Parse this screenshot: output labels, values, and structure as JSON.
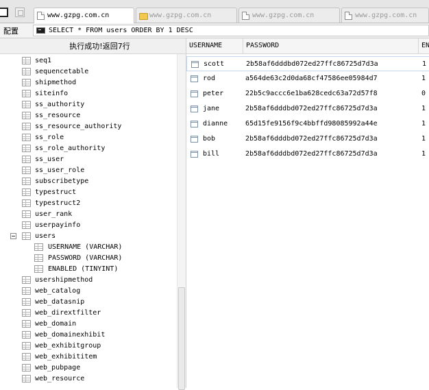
{
  "tabs": [
    {
      "label": "www.gzpg.com.cn",
      "icon": "page-icon",
      "active": true
    },
    {
      "label": "www.gzpg.com.cn",
      "icon": "folder-icon",
      "active": false
    },
    {
      "label": "www.gzpg.com.cn",
      "icon": "page-icon",
      "active": false
    },
    {
      "label": "www.gzpg.com.cn",
      "icon": "page-icon",
      "active": false
    }
  ],
  "toolbar": {
    "config_label": "配置",
    "sql": "SELECT * FROM users ORDER BY 1 DESC"
  },
  "status": "执行成功!返回7行",
  "tree": [
    {
      "label": "seq1",
      "level": 0
    },
    {
      "label": "sequencetable",
      "level": 0
    },
    {
      "label": "shipmethod",
      "level": 0
    },
    {
      "label": "siteinfo",
      "level": 0
    },
    {
      "label": "ss_authority",
      "level": 0
    },
    {
      "label": "ss_resource",
      "level": 0
    },
    {
      "label": "ss_resource_authority",
      "level": 0
    },
    {
      "label": "ss_role",
      "level": 0
    },
    {
      "label": "ss_role_authority",
      "level": 0
    },
    {
      "label": "ss_user",
      "level": 0
    },
    {
      "label": "ss_user_role",
      "level": 0
    },
    {
      "label": "subscribetype",
      "level": 0
    },
    {
      "label": "typestruct",
      "level": 0
    },
    {
      "label": "typestruct2",
      "level": 0
    },
    {
      "label": "user_rank",
      "level": 0
    },
    {
      "label": "userpayinfo",
      "level": 0
    },
    {
      "label": "users",
      "level": 0,
      "expanded": true
    },
    {
      "label": "USERNAME (VARCHAR)",
      "level": 1
    },
    {
      "label": "PASSWORD (VARCHAR)",
      "level": 1
    },
    {
      "label": "ENABLED (TINYINT)",
      "level": 1
    },
    {
      "label": "usershipmethod",
      "level": 0
    },
    {
      "label": "web_catalog",
      "level": 0
    },
    {
      "label": "web_datasnip",
      "level": 0
    },
    {
      "label": "web_dirextfilter",
      "level": 0
    },
    {
      "label": "web_domain",
      "level": 0
    },
    {
      "label": "web_domainexhibit",
      "level": 0
    },
    {
      "label": "web_exhibitgroup",
      "level": 0
    },
    {
      "label": "web_exhibititem",
      "level": 0
    },
    {
      "label": "web_pubpage",
      "level": 0
    },
    {
      "label": "web_resource",
      "level": 0
    }
  ],
  "grid": {
    "columns": [
      "USERNAME",
      "PASSWORD",
      "EN"
    ],
    "rows": [
      [
        "scott",
        "2b58af6dddbd072ed27ffc86725d7d3a",
        "1"
      ],
      [
        "rod",
        "a564de63c2d0da68cf47586ee05984d7",
        "1"
      ],
      [
        "peter",
        "22b5c9accc6e1ba628cedc63a72d57f8",
        "0"
      ],
      [
        "jane",
        "2b58af6dddbd072ed27ffc86725d7d3a",
        "1"
      ],
      [
        "dianne",
        "65d15fe9156f9c4bbffd98085992a44e",
        "1"
      ],
      [
        "bob",
        "2b58af6dddbd072ed27ffc86725d7d3a",
        "1"
      ],
      [
        "bill",
        "2b58af6dddbd072ed27ffc86725d7d3a",
        "1"
      ]
    ]
  }
}
